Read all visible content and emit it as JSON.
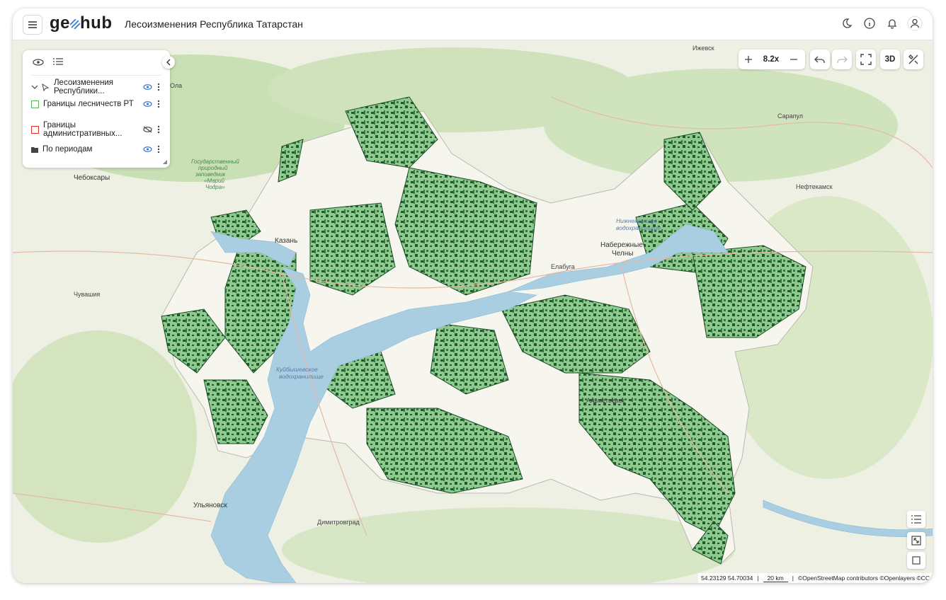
{
  "app": {
    "logo_geo": "ge",
    "logo_hub": "hub",
    "title": "Лесоизменения Республика Татарстан"
  },
  "topbar_icons": [
    "menu-icon",
    "moon-icon",
    "info-icon",
    "bell-icon",
    "user-icon"
  ],
  "layers": [
    {
      "name": "Лесоизменения Республики...",
      "type": "group",
      "visible": true
    },
    {
      "name": "Границы лесничеств РТ",
      "type": "polygon",
      "color": "#59b35f",
      "visible": true
    },
    {
      "name": "Границы административных...",
      "type": "polygon",
      "color": "#d9332b",
      "visible": false
    },
    {
      "name": "По периодам",
      "type": "folder",
      "visible": true
    }
  ],
  "map_controls": {
    "zoom_level": "8.2x",
    "btn_3d": "3D"
  },
  "map_labels": {
    "izhevsk": "Ижевск",
    "sarapul": "Сарапул",
    "neftekamsk": "Нефтекамск",
    "cheboksary": "Чебоксары",
    "kazan": "Казань",
    "chelny_1": "Набережные",
    "chelny_2": "Челны",
    "chuvashia": "Чувашия",
    "ulyanovsk": "Ульяновск",
    "dimitrovgrad": "Димитровград",
    "almetyevsk": "Альметьевск",
    "ola": "Ола",
    "elabuga": "Елабуга",
    "kuib_1": "Куйбышевское",
    "kuib_2": "водохранилище",
    "nizhnekamsk_1": "Нижнекамское",
    "nizhnekamsk_2": "водохранилище",
    "park_1": "Государственный",
    "park_2": "природный",
    "park_3": "заповедник",
    "park_4": "«Марий",
    "park_5": "Чодра»"
  },
  "status": {
    "coords": "54.23129 54.70034",
    "scale": "20 km",
    "attribution": "©OpenStreetMap contributors ©Openlayers ©CC"
  }
}
